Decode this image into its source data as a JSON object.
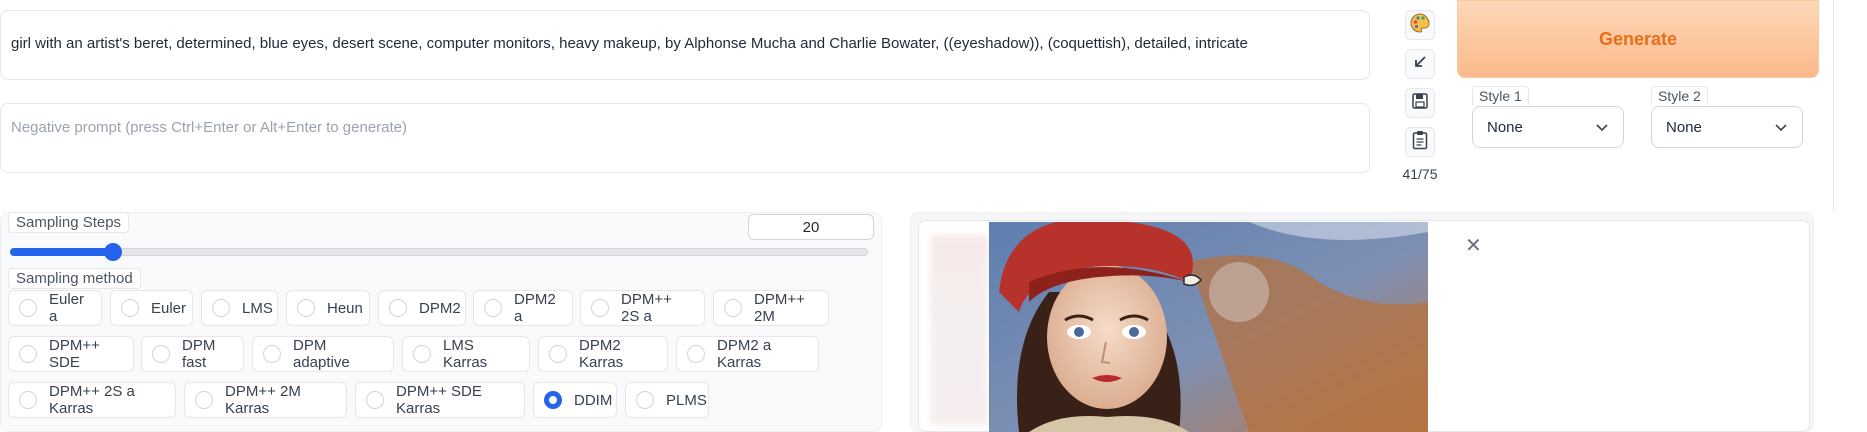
{
  "prompt": {
    "positive": "girl with an artist's beret, determined, blue eyes, desert scene, computer monitors, heavy makeup, by Alphonse Mucha and Charlie Bowater, ((eyeshadow)), (coquettish), detailed, intricate",
    "negative_placeholder": "Negative prompt (press Ctrl+Enter or Alt+Enter to generate)",
    "token_count": "41/75"
  },
  "tools": {
    "icons": [
      "palette-icon",
      "arrow-down-left-icon",
      "save-icon",
      "clipboard-icon"
    ]
  },
  "generate": {
    "label": "Generate"
  },
  "styles": {
    "style1": {
      "label": "Style 1",
      "value": "None"
    },
    "style2": {
      "label": "Style 2",
      "value": "None"
    }
  },
  "sampling_steps": {
    "label": "Sampling Steps",
    "value": "20",
    "min": 1,
    "max": 150,
    "fraction": 0.12
  },
  "sampling_method": {
    "label": "Sampling method",
    "options": [
      "Euler a",
      "Euler",
      "LMS",
      "Heun",
      "DPM2",
      "DPM2 a",
      "DPM++ 2S a",
      "DPM++ 2M",
      "DPM++ SDE",
      "DPM fast",
      "DPM adaptive",
      "LMS Karras",
      "DPM2 Karras",
      "DPM2 a Karras",
      "DPM++ 2S a Karras",
      "DPM++ 2M Karras",
      "DPM++ SDE Karras",
      "DDIM",
      "PLMS"
    ],
    "selected": "DDIM"
  },
  "gallery": {
    "close_icon": "close-icon"
  },
  "colors": {
    "accent": "#2563eb",
    "generate_text": "#ea6d1a",
    "generate_bg": "#fbb98a"
  }
}
